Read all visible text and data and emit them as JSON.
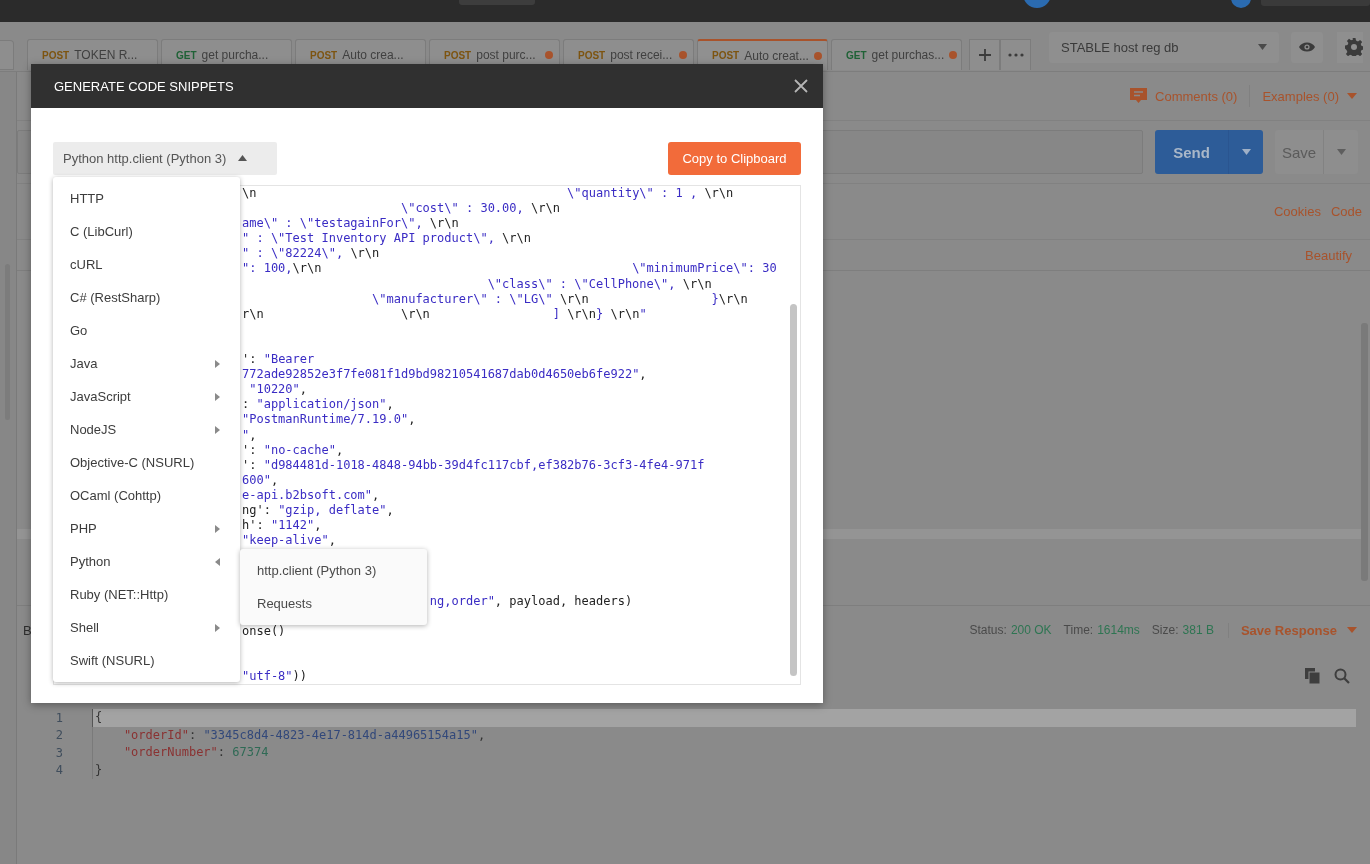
{
  "tabs": [
    {
      "method": {
        "text": "POST",
        "color": "#7d5410"
      },
      "label": "TOKEN R...",
      "unsaved": false,
      "selected": false
    },
    {
      "method": {
        "text": "GET",
        "color": "#1f6236"
      },
      "label": "get purcha...",
      "unsaved": false,
      "selected": false
    },
    {
      "method": {
        "text": "POST",
        "color": "#7d5410"
      },
      "label": "Auto crea...",
      "unsaved": false,
      "selected": false
    },
    {
      "method": {
        "text": "POST",
        "color": "#7d5410"
      },
      "label": "post purc...",
      "unsaved": true,
      "selected": false
    },
    {
      "method": {
        "text": "POST",
        "color": "#7d5410"
      },
      "label": "post recei...",
      "unsaved": true,
      "selected": false
    },
    {
      "method": {
        "text": "POST",
        "color": "#7d5410"
      },
      "label": "Auto creat...",
      "unsaved": true,
      "selected": true
    },
    {
      "method": {
        "text": "GET",
        "color": "#1f6236"
      },
      "label": "get purchas...",
      "unsaved": true,
      "selected": false
    }
  ],
  "environment": {
    "value": "STABLE host reg db"
  },
  "request": {
    "comments": "Comments (0)",
    "examples": "Examples (0)",
    "send": "Send",
    "save": "Save",
    "links": [
      "Cookies",
      "Code"
    ],
    "beautify": "Beautify"
  },
  "response": {
    "tab": "B",
    "status_label": "Status:",
    "status": "200 OK",
    "time_label": "Time:",
    "time": "1614ms",
    "size_label": "Size:",
    "size": "381 B",
    "save": "Save Response",
    "lines": [
      {
        "number": "1",
        "current": true,
        "segments": [
          {
            "kind": "punct",
            "text": "{"
          }
        ]
      },
      {
        "number": "2",
        "current": false,
        "segments": [
          {
            "kind": "key",
            "text": "    \"orderId\""
          },
          {
            "kind": "punct",
            "text": ": "
          },
          {
            "kind": "string",
            "text": "\"3345c8d4-4823-4e17-814d-a44965154a15\""
          },
          {
            "kind": "punct",
            "text": ","
          }
        ]
      },
      {
        "number": "3",
        "current": false,
        "segments": [
          {
            "kind": "key",
            "text": "    \"orderNumber\""
          },
          {
            "kind": "punct",
            "text": ": "
          },
          {
            "kind": "number",
            "text": "67374"
          }
        ]
      },
      {
        "number": "4",
        "current": false,
        "segments": [
          {
            "kind": "punct",
            "text": "}"
          }
        ]
      }
    ]
  },
  "modal": {
    "title": "GENERATE CODE SNIPPETS",
    "language": "Python http.client (Python 3)",
    "open": true,
    "copy": "Copy to Clipboard",
    "code_lines": [
      {
        "kind": "code",
        "segments": [
          {
            "kind": "plain",
            "text": "\\n                                           "
          },
          {
            "kind": "string",
            "text": "\\\"quantity\\\" : 1 , "
          },
          {
            "kind": "plain",
            "text": "\\r\\n"
          }
        ]
      },
      {
        "kind": "code",
        "segments": [
          {
            "kind": "string",
            "text": "                      \\\"cost\\\" : 30.00, "
          },
          {
            "kind": "plain",
            "text": "\\r\\n"
          }
        ]
      },
      {
        "kind": "code",
        "segments": [
          {
            "kind": "string",
            "text": "ame\\\" : \\\"testagainFor\\\", "
          },
          {
            "kind": "plain",
            "text": "\\r\\n"
          }
        ]
      },
      {
        "kind": "code",
        "segments": [
          {
            "kind": "string",
            "text": "\" : \\\"Test Inventory API product\\\", "
          },
          {
            "kind": "plain",
            "text": "\\r\\n"
          }
        ]
      },
      {
        "kind": "code",
        "segments": [
          {
            "kind": "string",
            "text": "\" : \\\"82224\\\", "
          },
          {
            "kind": "plain",
            "text": "\\r\\n"
          }
        ]
      },
      {
        "kind": "code",
        "segments": [
          {
            "kind": "string",
            "text": "\": 100,"
          },
          {
            "kind": "plain",
            "text": "\\r\\n                                           "
          },
          {
            "kind": "string",
            "text": "\\\"minimumPrice\\\": 30"
          }
        ]
      },
      {
        "kind": "code",
        "segments": [
          {
            "kind": "string",
            "text": "                                  \\\"class\\\" : \\\"CellPhone\\\", "
          },
          {
            "kind": "plain",
            "text": "\\r\\n"
          }
        ]
      },
      {
        "kind": "code",
        "segments": [
          {
            "kind": "string",
            "text": "                  \\\"manufacturer\\\" : \\\"LG\\\" "
          },
          {
            "kind": "plain",
            "text": "\\r\\n                 "
          },
          {
            "kind": "string",
            "text": "}"
          },
          {
            "kind": "plain",
            "text": "\\r\\n"
          }
        ]
      },
      {
        "kind": "code",
        "segments": [
          {
            "kind": "plain",
            "text": "r\\n                   \\r\\n                 "
          },
          {
            "kind": "string",
            "text": "]"
          },
          {
            "kind": "plain",
            "text": " \\r\\n"
          },
          {
            "kind": "string",
            "text": "}"
          },
          {
            "kind": "plain",
            "text": " \\r\\n"
          },
          {
            "kind": "string",
            "text": "\""
          }
        ]
      },
      {
        "kind": "blank"
      },
      {
        "kind": "blank"
      },
      {
        "kind": "code",
        "segments": [
          {
            "kind": "plain",
            "text": "': "
          },
          {
            "kind": "string",
            "text": "\"Bearer"
          }
        ]
      },
      {
        "kind": "code",
        "segments": [
          {
            "kind": "string",
            "text": "772ade92852e3f7fe081f1d9bd98210541687dab0d4650eb6fe922\""
          },
          {
            "kind": "plain",
            "text": ","
          }
        ]
      },
      {
        "kind": "code",
        "segments": [
          {
            "kind": "string",
            "text": " \"10220\""
          },
          {
            "kind": "plain",
            "text": ","
          }
        ]
      },
      {
        "kind": "code",
        "segments": [
          {
            "kind": "plain",
            "text": ": "
          },
          {
            "kind": "string",
            "text": "\"application/json\""
          },
          {
            "kind": "plain",
            "text": ","
          }
        ]
      },
      {
        "kind": "code",
        "segments": [
          {
            "kind": "string",
            "text": "\"PostmanRuntime/7.19.0\""
          },
          {
            "kind": "plain",
            "text": ","
          }
        ]
      },
      {
        "kind": "code",
        "segments": [
          {
            "kind": "string",
            "text": "\""
          },
          {
            "kind": "plain",
            "text": ","
          }
        ]
      },
      {
        "kind": "code",
        "segments": [
          {
            "kind": "plain",
            "text": "': "
          },
          {
            "kind": "string",
            "text": "\"no-cache\""
          },
          {
            "kind": "plain",
            "text": ","
          }
        ]
      },
      {
        "kind": "code",
        "segments": [
          {
            "kind": "plain",
            "text": "': "
          },
          {
            "kind": "string",
            "text": "\"d984481d-1018-4848-94bb-39d4fc117cbf,ef382b76-3cf3-4fe4-971f"
          }
        ]
      },
      {
        "kind": "code",
        "segments": [
          {
            "kind": "string",
            "text": "600\""
          },
          {
            "kind": "plain",
            "text": ","
          }
        ]
      },
      {
        "kind": "code",
        "segments": [
          {
            "kind": "string",
            "text": "e-api.b2bsoft.com\""
          },
          {
            "kind": "plain",
            "text": ","
          }
        ]
      },
      {
        "kind": "code",
        "segments": [
          {
            "kind": "plain",
            "text": "ng': "
          },
          {
            "kind": "string",
            "text": "\"gzip, deflate\""
          },
          {
            "kind": "plain",
            "text": ","
          }
        ]
      },
      {
        "kind": "code",
        "segments": [
          {
            "kind": "plain",
            "text": "h': "
          },
          {
            "kind": "string",
            "text": "\"1142\""
          },
          {
            "kind": "plain",
            "text": ","
          }
        ]
      },
      {
        "kind": "code",
        "segments": [
          {
            "kind": "string",
            "text": "\"keep-alive\""
          },
          {
            "kind": "plain",
            "text": ","
          }
        ]
      },
      {
        "kind": "blank"
      },
      {
        "kind": "blank"
      },
      {
        "kind": "blank"
      },
      {
        "kind": "code",
        "segments": [
          {
            "kind": "string",
            "text": "                          ng,order\""
          },
          {
            "kind": "plain",
            "text": ", payload, headers)"
          }
        ]
      },
      {
        "kind": "blank"
      },
      {
        "kind": "code",
        "segments": [
          {
            "kind": "plain",
            "text": "onse()"
          }
        ]
      },
      {
        "kind": "blank"
      },
      {
        "kind": "blank"
      },
      {
        "kind": "code",
        "segments": [
          {
            "kind": "string",
            "text": "\"utf-8\""
          },
          {
            "kind": "plain",
            "text": "))"
          }
        ]
      }
    ],
    "menu": [
      {
        "label": "HTTP",
        "has_submenu": false,
        "expanded": false
      },
      {
        "label": "C (LibCurl)",
        "has_submenu": false,
        "expanded": false
      },
      {
        "label": "cURL",
        "has_submenu": false,
        "expanded": false
      },
      {
        "label": "C# (RestSharp)",
        "has_submenu": false,
        "expanded": false
      },
      {
        "label": "Go",
        "has_submenu": false,
        "expanded": false
      },
      {
        "label": "Java",
        "has_submenu": true,
        "expanded": false
      },
      {
        "label": "JavaScript",
        "has_submenu": true,
        "expanded": false
      },
      {
        "label": "NodeJS",
        "has_submenu": true,
        "expanded": false
      },
      {
        "label": "Objective-C (NSURL)",
        "has_submenu": false,
        "expanded": false
      },
      {
        "label": "OCaml (Cohttp)",
        "has_submenu": false,
        "expanded": false
      },
      {
        "label": "PHP",
        "has_submenu": true,
        "expanded": false
      },
      {
        "label": "Python",
        "has_submenu": true,
        "expanded": true
      },
      {
        "label": "Ruby (NET::Http)",
        "has_submenu": false,
        "expanded": false
      },
      {
        "label": "Shell",
        "has_submenu": true,
        "expanded": false
      },
      {
        "label": "Swift (NSURL)",
        "has_submenu": false,
        "expanded": false
      }
    ],
    "submenu": [
      {
        "label": "http.client (Python 3)"
      },
      {
        "label": "Requests"
      }
    ]
  }
}
